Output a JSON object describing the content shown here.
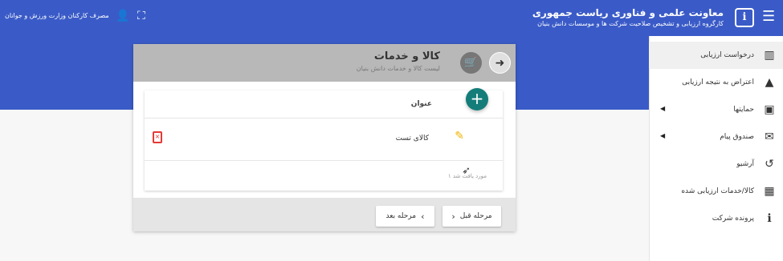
{
  "header": {
    "title": "معاونت علمی و فناوری ریاست جمهوری",
    "subtitle": "کارگروه ارزیابی و تشخیص صلاحیت شرکت ها و موسسات دانش بنیان",
    "user_name": "مصرف کارکنان وزارت ورزش و جوانان",
    "menu_icon": "menu-icon",
    "emblem_icon": "emblem-icon",
    "user_icon": "user-icon",
    "fullscreen_icon": "fullscreen-icon"
  },
  "sidebar": {
    "items": [
      {
        "label": "درخواست ارزیابی",
        "icon": "bar-chart-icon",
        "glyph": "▥",
        "active": true,
        "has_submenu": false
      },
      {
        "label": "اعتراض به نتیجه ارزیابی",
        "icon": "warning-icon",
        "glyph": "▲",
        "active": false,
        "has_submenu": false
      },
      {
        "label": "حمایتها",
        "icon": "briefcase-icon",
        "glyph": "▣",
        "active": false,
        "has_submenu": true
      },
      {
        "label": "صندوق پیام",
        "icon": "mail-icon",
        "glyph": "✉",
        "active": false,
        "has_submenu": true
      },
      {
        "label": "آرشیو",
        "icon": "history-icon",
        "glyph": "↺",
        "active": false,
        "has_submenu": false
      },
      {
        "label": "کالا/خدمات ارزیابی شده",
        "icon": "table-icon",
        "glyph": "▦",
        "active": false,
        "has_submenu": false
      },
      {
        "label": "پرونده شرکت",
        "icon": "info-icon",
        "glyph": "ℹ",
        "active": false,
        "has_submenu": false
      }
    ],
    "submenu_arrow": "◀"
  },
  "panel": {
    "title": "کالا و خدمات",
    "subtitle": "لیست کالا و خدمات دانش بنیان",
    "back_icon": "arrow-right-icon",
    "basket_icon": "basket-icon",
    "list": {
      "column_header": "عنوان",
      "add_icon": "plus-icon",
      "rows": [
        {
          "title": "کالای تست",
          "edit_icon": "pencil-icon",
          "delete_icon": "delete-icon"
        }
      ],
      "pager_text": "۱ مورد یافت شد"
    },
    "footer": {
      "prev_label": "مرحله قبل",
      "next_label": "مرحله بعد"
    }
  },
  "colors": {
    "primary": "#3a5bc7",
    "fab": "#147d7a",
    "edit": "#f0b400",
    "delete": "#e53935"
  }
}
